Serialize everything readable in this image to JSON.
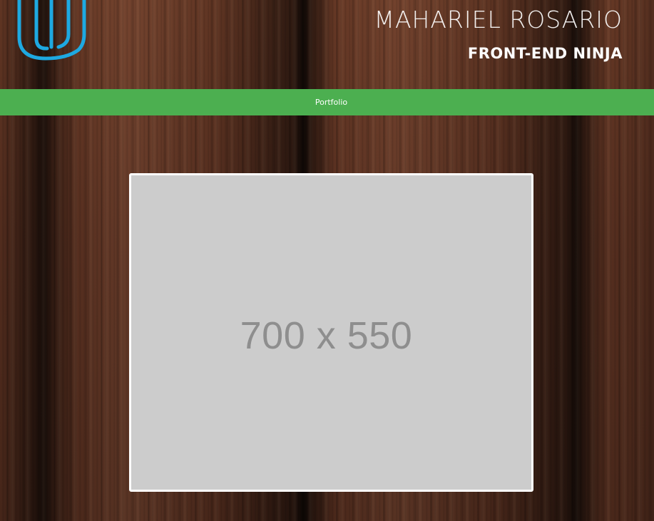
{
  "header": {
    "name": "MAHARIEL ROSARIO",
    "subtitle": "FRONT-END NINJA",
    "logo_icon": "udacity-u-logo-icon",
    "logo_color": "#1ea9e1"
  },
  "nav": {
    "items": [
      {
        "label": "Portfolio"
      }
    ],
    "color": "#4caf50"
  },
  "main": {
    "placeholder_label": "700 x 550"
  }
}
